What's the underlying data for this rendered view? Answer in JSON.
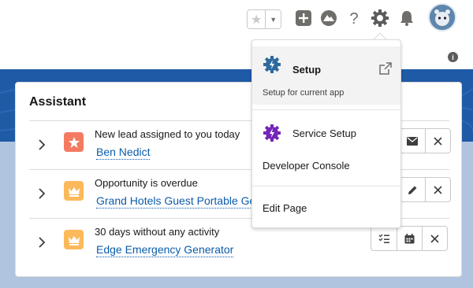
{
  "header": {
    "icons": [
      "star-icon",
      "chevron-down-icon",
      "add-icon",
      "trailhead-icon",
      "help-icon",
      "setup-gear-icon",
      "notification-bell-icon",
      "avatar",
      "info-icon"
    ]
  },
  "assistant": {
    "title": "Assistant",
    "rows": [
      {
        "message": "New lead assigned to you today",
        "link": "Ben Nedict",
        "icon": "lead-star-icon",
        "icon_color": "#f47b61",
        "actions": [
          "email-icon",
          "close-icon"
        ]
      },
      {
        "message": "Opportunity is overdue",
        "link": "Grand Hotels Guest Portable Gene",
        "icon": "opportunity-crown-icon",
        "icon_color": "#fcb95b",
        "actions": [
          "edit-icon",
          "close-icon"
        ]
      },
      {
        "message": "30 days without any activity",
        "link": "Edge Emergency Generator",
        "icon": "opportunity-crown-icon",
        "icon_color": "#fcb95b",
        "actions": [
          "task-icon",
          "calendar-icon",
          "close-icon"
        ]
      }
    ]
  },
  "setup_menu": {
    "setup_label": "Setup",
    "setup_sub": "Setup for current app",
    "service_setup_label": "Service Setup",
    "developer_console_label": "Developer Console",
    "edit_page_label": "Edit Page"
  },
  "colors": {
    "brand_blue": "#1f5aa6",
    "link_blue": "#0b5cab",
    "setup_gear": "#2e6a9e",
    "service_gear": "#7526b8"
  }
}
